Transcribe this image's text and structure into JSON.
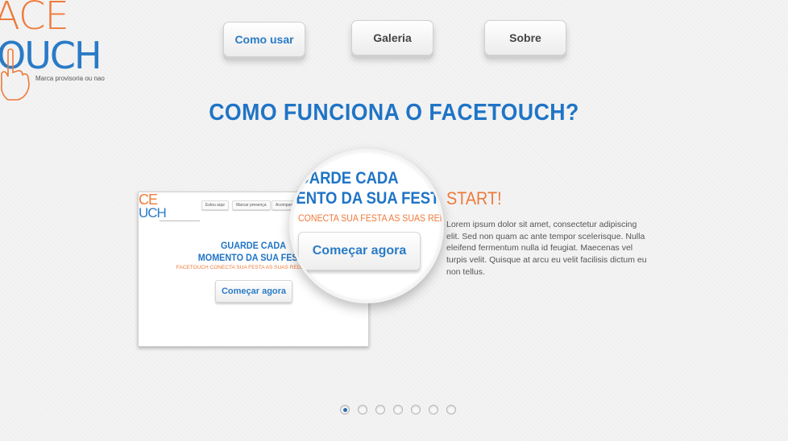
{
  "logo": {
    "line1": "ACE",
    "line2": "OUCH",
    "tagline": "Marca provisoria ou nao",
    "icon": "hand-pointer-icon"
  },
  "nav": {
    "items": [
      {
        "label": "Como usar",
        "active": true
      },
      {
        "label": "Galeria",
        "active": false
      },
      {
        "label": "Sobre",
        "active": false
      }
    ]
  },
  "heading": "COMO FUNCIONA O FACETOUCH?",
  "screenshot_preview": {
    "logo_line1": "CE",
    "logo_line2": "UCH",
    "nav": [
      "Estou aqui",
      "Marcar presença",
      "Acompanhe"
    ],
    "headline_1": "GUARDE CADA",
    "headline_2": "MOMENTO DA SUA FESTA",
    "subtitle": "FACETOUCH CONECTA SUA FESTA AS SUAS REDES SOCIAIS",
    "button": "Começar agora"
  },
  "magnifier": {
    "line1": "GUARDE CADA",
    "line2": "MENTO DA SUA FESTA",
    "subtitle": "CONECTA SUA FESTA AS SUAS REDES",
    "button": "Começar agora"
  },
  "start": {
    "title": "START!",
    "text": "Lorem ipsum dolor sit amet, consectetur adipiscing elit. Sed non quam ac ante tempor scelerisque. Nulla eleifend fermentum nulla id feugiat. Maecenas vel turpis velit. Quisque at arcu eu velit facilisis dictum eu non tellus."
  },
  "pagination": {
    "count": 7,
    "active_index": 0
  },
  "colors": {
    "blue": "#1f74c6",
    "orange": "#ee7a3a",
    "background": "#f3f3f3"
  }
}
